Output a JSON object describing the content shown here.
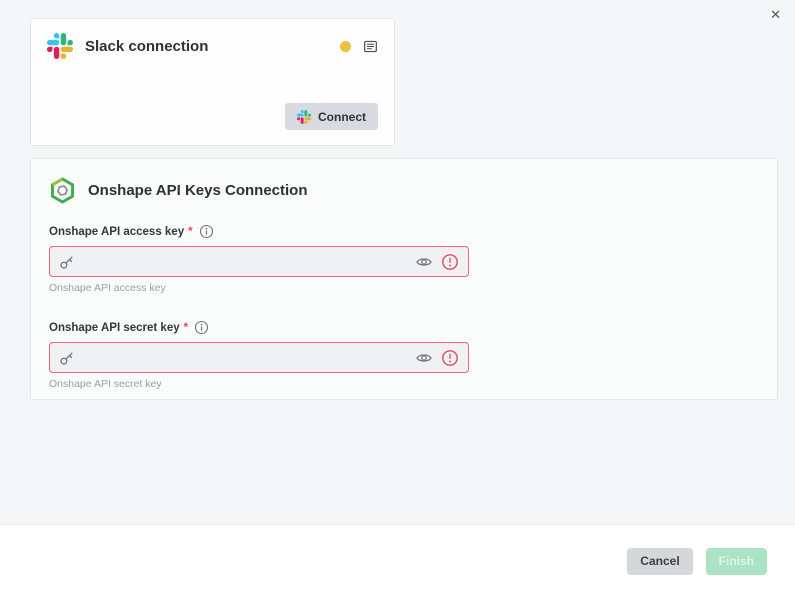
{
  "modal": {
    "close_glyph": "✕"
  },
  "slack_card": {
    "title": "Slack connection",
    "status_color": "#edc13c",
    "connect_label": "Connect"
  },
  "onshape_card": {
    "title": "Onshape API Keys Connection",
    "fields": [
      {
        "label": "Onshape API access key",
        "required_mark": "*",
        "value": "",
        "helper": "Onshape API access key"
      },
      {
        "label": "Onshape API secret key",
        "required_mark": "*",
        "value": "",
        "helper": "Onshape API secret key"
      }
    ]
  },
  "footer": {
    "cancel_label": "Cancel",
    "finish_label": "Finish"
  },
  "colors": {
    "backdrop": "#f5f6f7",
    "card_border": "#e5e7e9",
    "input_error_border": "#e96379",
    "error_icon": "#e84a64",
    "required_asterisk": "#e5484d",
    "cancel_bg": "#d4d8db",
    "finish_bg": "#abe3c7",
    "status_dot": "#edc13c"
  }
}
